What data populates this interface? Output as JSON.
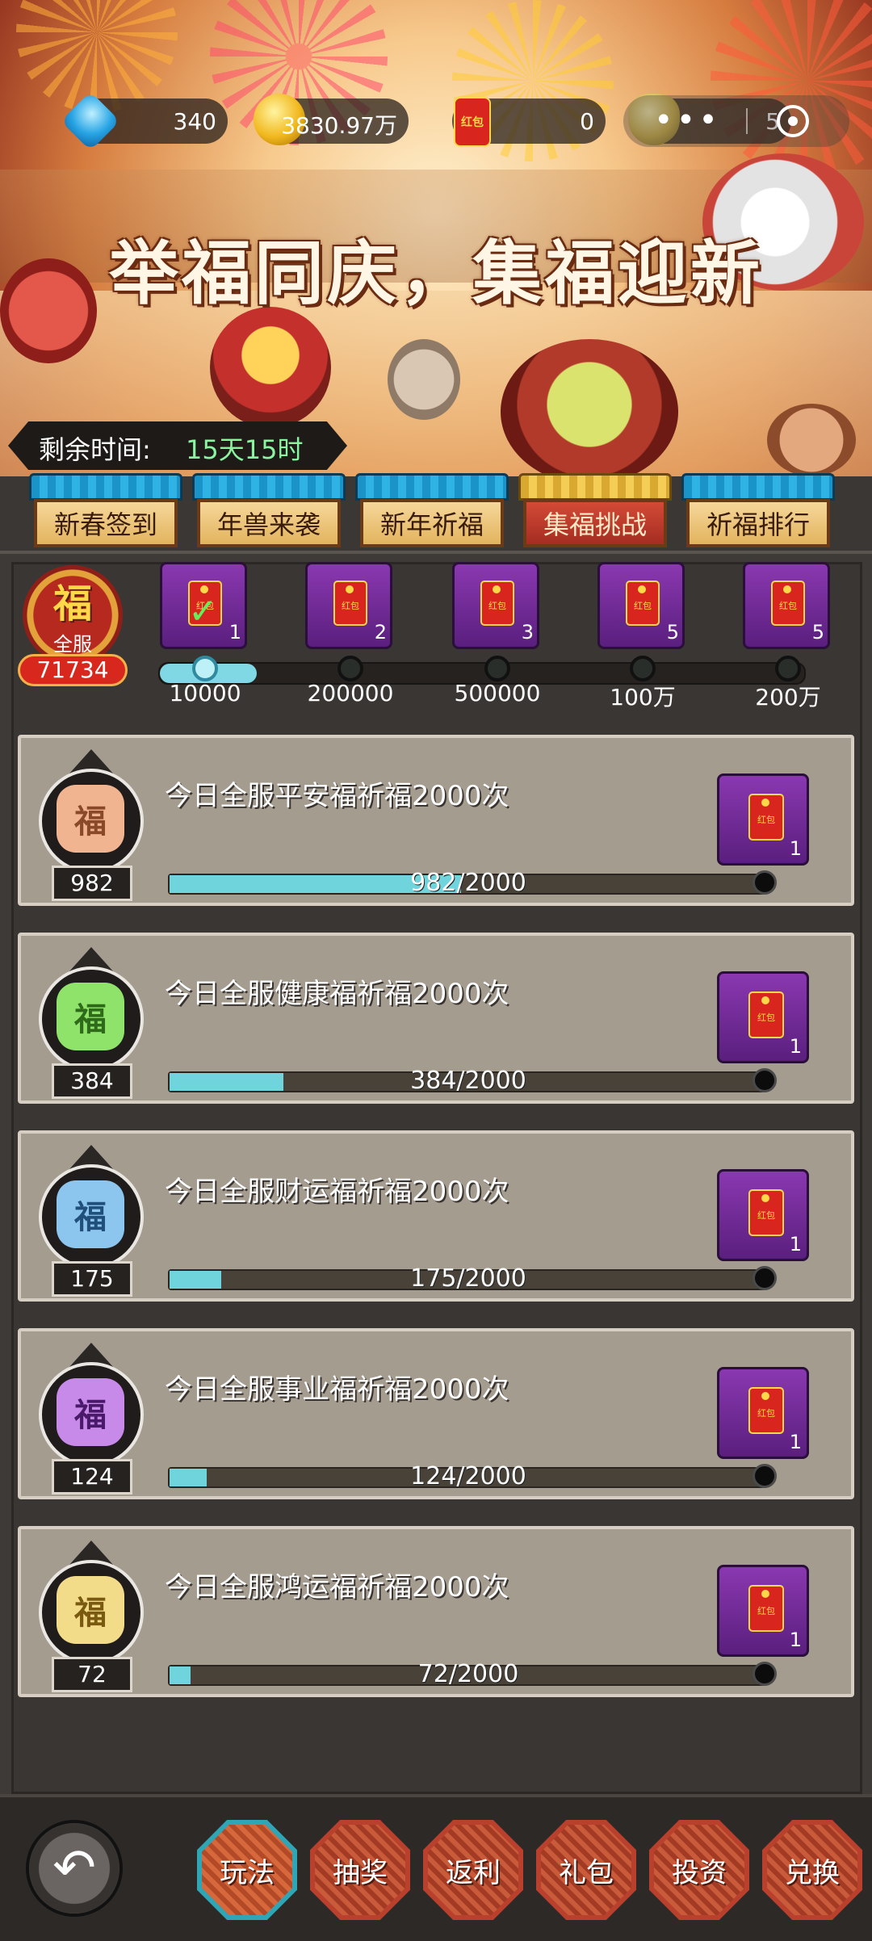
{
  "currency": {
    "gems": "340",
    "gold": "3830.97万",
    "red_packets": "0",
    "ingots": "5",
    "red_packet_icon_label": "红包"
  },
  "banner": {
    "headline": "举福同庆，集福迎新"
  },
  "timer": {
    "label": "剩余时间:",
    "value": "15天15时"
  },
  "tabs": [
    {
      "label": "新春签到"
    },
    {
      "label": "年兽来袭"
    },
    {
      "label": "新年祈福"
    },
    {
      "label": "集福挑战"
    },
    {
      "label": "祈福排行"
    }
  ],
  "active_tab": "集福挑战",
  "global_fu": {
    "char": "福",
    "label": "全服",
    "count": "71734"
  },
  "milestones": [
    {
      "reward_count": "1",
      "threshold": "10000",
      "claimed": true
    },
    {
      "reward_count": "2",
      "threshold": "200000",
      "claimed": false
    },
    {
      "reward_count": "3",
      "threshold": "500000",
      "claimed": false
    },
    {
      "reward_count": "5",
      "threshold": "100万",
      "claimed": false
    },
    {
      "reward_count": "5",
      "threshold": "200万",
      "claimed": false
    }
  ],
  "tasks": [
    {
      "title": "今日全服平安福祈福2000次",
      "count": "982",
      "progress": "982/2000",
      "fraction": 0.491,
      "reward_count": "1",
      "fu": "福",
      "color": "#f0b490"
    },
    {
      "title": "今日全服健康福祈福2000次",
      "count": "384",
      "progress": "384/2000",
      "fraction": 0.192,
      "reward_count": "1",
      "fu": "福",
      "color": "#8fe36a"
    },
    {
      "title": "今日全服财运福祈福2000次",
      "count": "175",
      "progress": "175/2000",
      "fraction": 0.0875,
      "reward_count": "1",
      "fu": "福",
      "color": "#8cc6ef"
    },
    {
      "title": "今日全服事业福祈福2000次",
      "count": "124",
      "progress": "124/2000",
      "fraction": 0.062,
      "reward_count": "1",
      "fu": "福",
      "color": "#c88ae8"
    },
    {
      "title": "今日全服鸿运福祈福2000次",
      "count": "72",
      "progress": "72/2000",
      "fraction": 0.036,
      "reward_count": "1",
      "fu": "福",
      "color": "#f2dc8a"
    }
  ],
  "bottom_nav": [
    {
      "label": "玩法"
    },
    {
      "label": "抽奖"
    },
    {
      "label": "返利"
    },
    {
      "label": "礼包"
    },
    {
      "label": "投资"
    },
    {
      "label": "兑换"
    }
  ],
  "active_nav": "玩法",
  "icons": {
    "back": "back-arrow-icon",
    "menu": "more-dots-icon",
    "close": "target-close-icon"
  }
}
